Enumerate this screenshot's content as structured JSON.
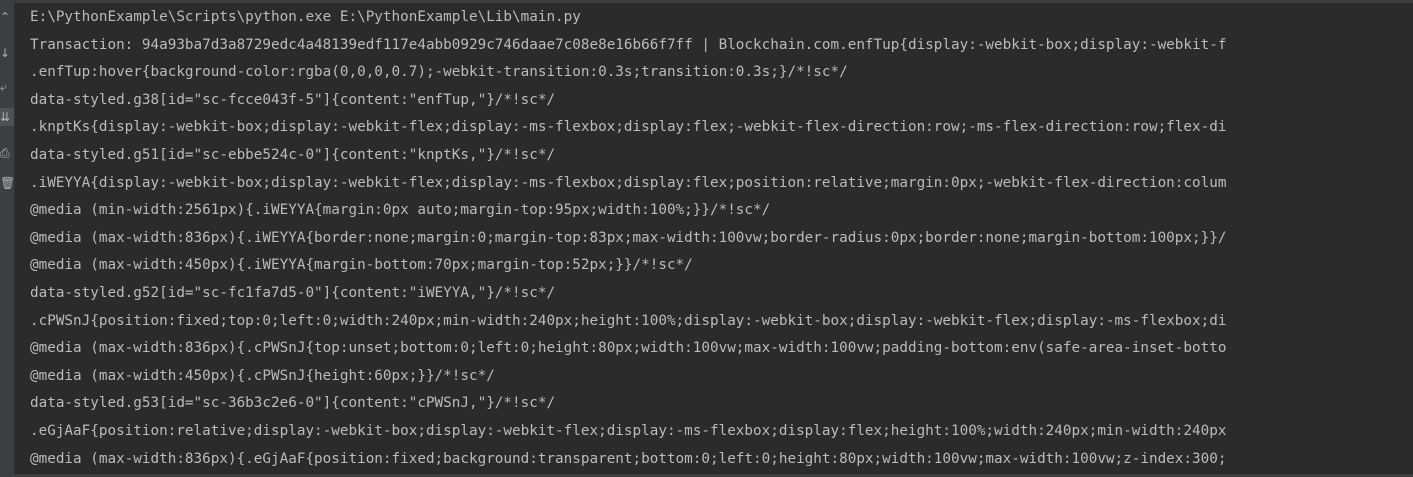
{
  "colors": {
    "background": "#2b2b2b",
    "gutter": "#3c3f41",
    "text": "#bbbbbb",
    "icon": "#afb1b3"
  },
  "gutter": {
    "icons": [
      {
        "name": "scroll-up-icon",
        "glyph": "⌃"
      },
      {
        "name": "arrow-down-icon",
        "glyph": "↓"
      },
      {
        "name": "soft-wrap-icon",
        "glyph": "⤶"
      },
      {
        "name": "scroll-to-end-icon",
        "glyph": "⇊"
      },
      {
        "name": "print-icon",
        "glyph": "⎙"
      },
      {
        "name": "delete-icon",
        "glyph": "🗑"
      }
    ]
  },
  "console": {
    "lines": [
      "E:\\PythonExample\\Scripts\\python.exe E:\\PythonExample\\Lib\\main.py",
      "Transaction: 94a93ba7d3a8729edc4a48139edf117e4abb0929c746daae7c08e8e16b66f7ff | Blockchain.com.enfTup{display:-webkit-box;display:-webkit-f",
      ".enfTup:hover{background-color:rgba(0,0,0,0.7);-webkit-transition:0.3s;transition:0.3s;}/*!sc*/",
      "data-styled.g38[id=\"sc-fcce043f-5\"]{content:\"enfTup,\"}/*!sc*/",
      ".knptKs{display:-webkit-box;display:-webkit-flex;display:-ms-flexbox;display:flex;-webkit-flex-direction:row;-ms-flex-direction:row;flex-di",
      "data-styled.g51[id=\"sc-ebbe524c-0\"]{content:\"knptKs,\"}/*!sc*/",
      ".iWEYYA{display:-webkit-box;display:-webkit-flex;display:-ms-flexbox;display:flex;position:relative;margin:0px;-webkit-flex-direction:colum",
      "@media (min-width:2561px){.iWEYYA{margin:0px auto;margin-top:95px;width:100%;}}/*!sc*/",
      "@media (max-width:836px){.iWEYYA{border:none;margin:0;margin-top:83px;max-width:100vw;border-radius:0px;border:none;margin-bottom:100px;}}/",
      "@media (max-width:450px){.iWEYYA{margin-bottom:70px;margin-top:52px;}}/*!sc*/",
      "data-styled.g52[id=\"sc-fc1fa7d5-0\"]{content:\"iWEYYA,\"}/*!sc*/",
      ".cPWSnJ{position:fixed;top:0;left:0;width:240px;min-width:240px;height:100%;display:-webkit-box;display:-webkit-flex;display:-ms-flexbox;di",
      "@media (max-width:836px){.cPWSnJ{top:unset;bottom:0;left:0;height:80px;width:100vw;max-width:100vw;padding-bottom:env(safe-area-inset-botto",
      "@media (max-width:450px){.cPWSnJ{height:60px;}}/*!sc*/",
      "data-styled.g53[id=\"sc-36b3c2e6-0\"]{content:\"cPWSnJ,\"}/*!sc*/",
      ".eGjAaF{position:relative;display:-webkit-box;display:-webkit-flex;display:-ms-flexbox;display:flex;height:100%;width:240px;min-width:240px",
      "@media (max-width:836px){.eGjAaF{position:fixed;background:transparent;bottom:0;left:0;height:80px;width:100vw;max-width:100vw;z-index:300;"
    ]
  }
}
